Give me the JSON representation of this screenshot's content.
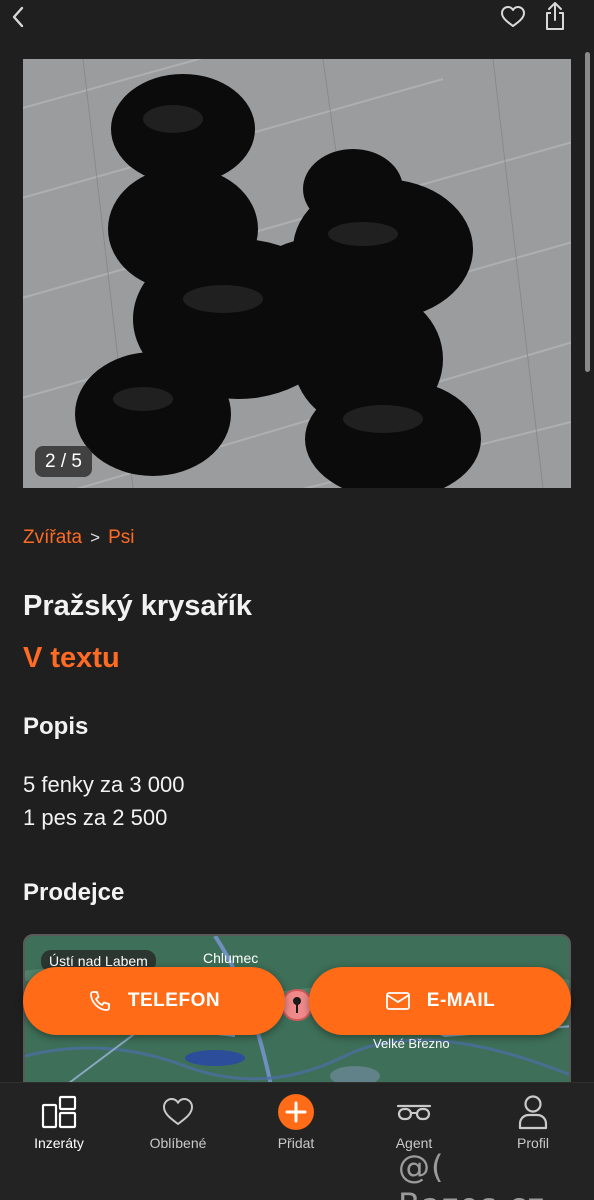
{
  "header": {
    "back_icon": "chevron-left-icon",
    "favorite_icon": "heart-icon",
    "share_icon": "share-icon"
  },
  "gallery": {
    "counter": "2 / 5"
  },
  "breadcrumb": {
    "items": [
      "Zvířata",
      "Psi"
    ],
    "separator": ">"
  },
  "listing": {
    "title": "Pražský krysařík",
    "price": "V textu",
    "description_heading": "Popis",
    "description_lines": [
      "5 fenky za 3 000",
      "1 pes za 2 500"
    ],
    "seller_heading": "Prodejce"
  },
  "map": {
    "labels": [
      "Ústí nad Labem",
      "Chlumec",
      "Velké Březno"
    ]
  },
  "contact": {
    "phone_label": "TELEFON",
    "email_label": "E-MAIL"
  },
  "tabbar": {
    "items": [
      {
        "label": "Inzeráty",
        "icon": "listings-icon",
        "active": true
      },
      {
        "label": "Oblíbené",
        "icon": "heart-icon",
        "active": false
      },
      {
        "label": "Přidat",
        "icon": "plus-circle-icon",
        "active": false
      },
      {
        "label": "Agent",
        "icon": "glasses-icon",
        "active": false
      },
      {
        "label": "Profil",
        "icon": "person-icon",
        "active": false
      }
    ]
  },
  "watermark": "@( Bazos.cz",
  "colors": {
    "accent": "#ff6b22",
    "background": "#1f1f1f",
    "tabbar": "#232323"
  }
}
